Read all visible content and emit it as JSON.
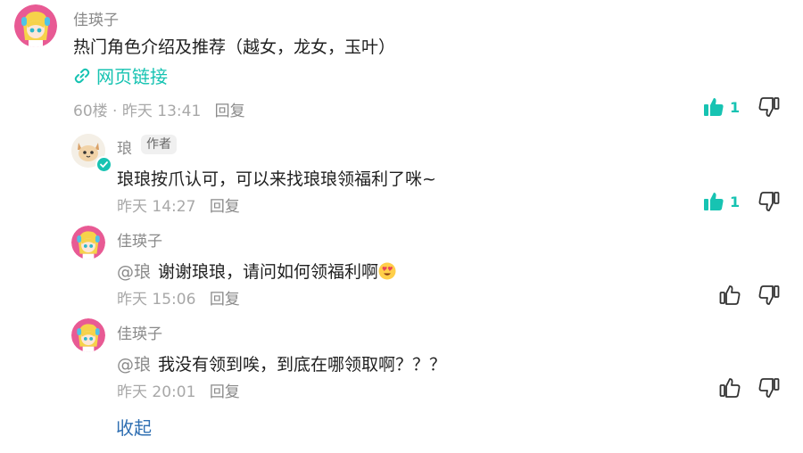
{
  "post": {
    "author": "佳瑛子",
    "content": "热门角色介绍及推荐（越女，龙女，玉叶）",
    "link_text": "网页链接",
    "floor": "60楼",
    "separator": "·",
    "time": "昨天 13:41",
    "reply_label": "回复",
    "like_count": "1"
  },
  "replies": [
    {
      "author": "琅",
      "badge": "作者",
      "mention": "",
      "content": "琅琅按爪认可，可以来找琅琅领福利了咪~",
      "time": "昨天 14:27",
      "reply_label": "回复",
      "like_count": "1",
      "liked": true
    },
    {
      "author": "佳瑛子",
      "mention": "@琅",
      "content": "谢谢琅琅，请问如何领福利啊",
      "time": "昨天 15:06",
      "reply_label": "回复",
      "liked": false
    },
    {
      "author": "佳瑛子",
      "mention": "@琅",
      "content": "我没有领到唉，到底在哪领取啊？？？",
      "time": "昨天 20:01",
      "reply_label": "回复",
      "liked": false
    }
  ],
  "collapse_label": "收起",
  "colors": {
    "accent": "#17c3b2",
    "muted": "#a8a8a8",
    "collapse": "#2f6fb2"
  },
  "icons": {
    "like_filled": "thumbs-up-filled-icon",
    "like_outline": "thumbs-up-outline-icon",
    "dislike": "thumbs-down-icon",
    "link": "link-icon",
    "verified": "verified-badge-icon",
    "emoji": "heart-eyes-emoji-icon"
  }
}
